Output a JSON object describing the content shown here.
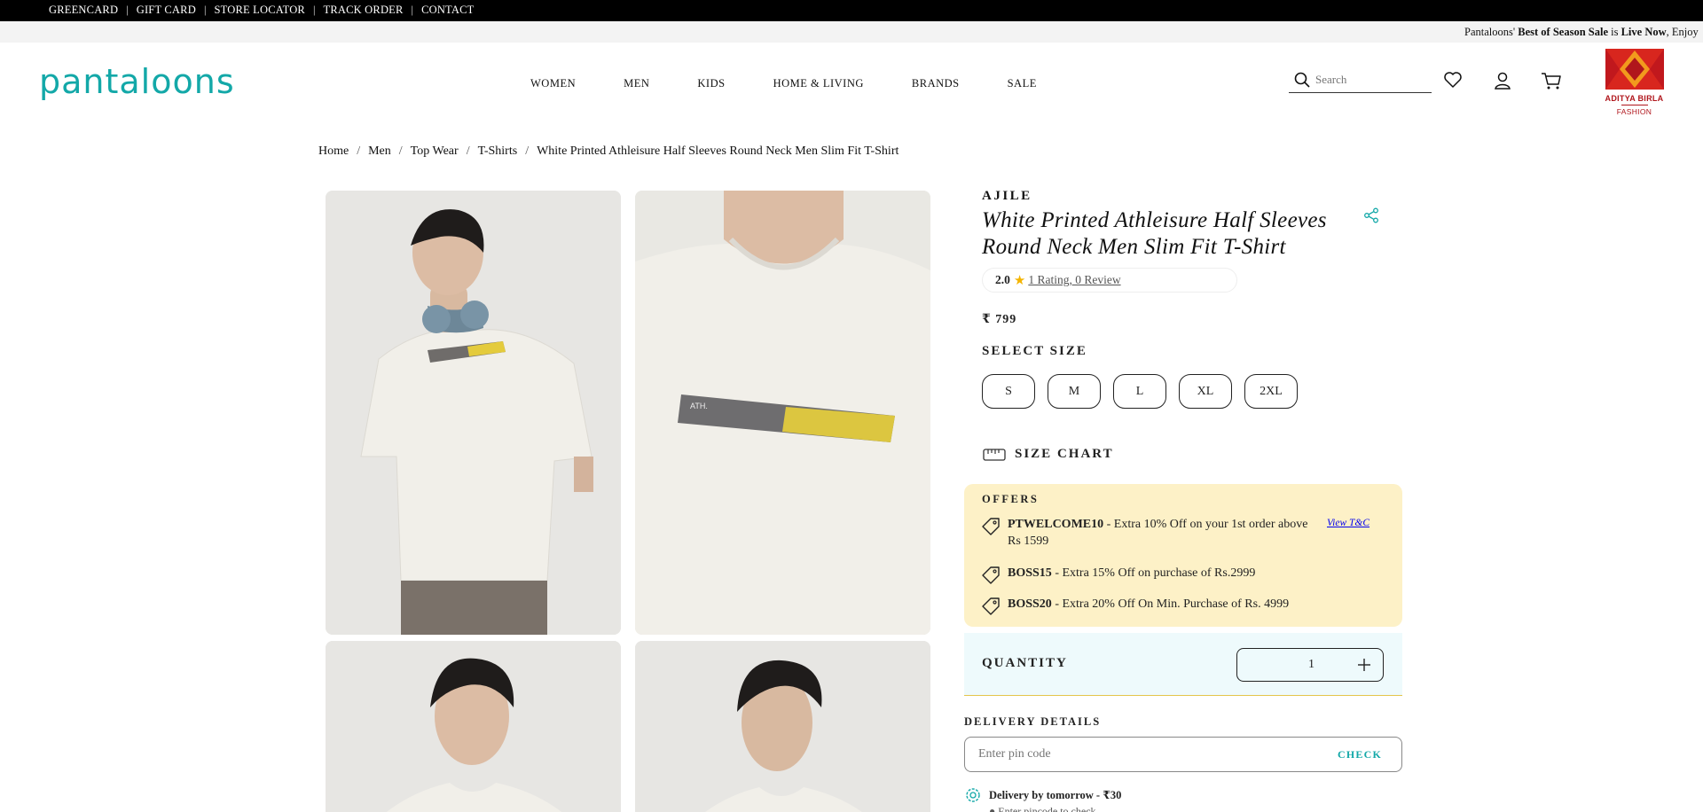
{
  "topbar": {
    "links": [
      "GREENCARD",
      "GIFT CARD",
      "STORE LOCATOR",
      "TRACK ORDER",
      "CONTACT"
    ]
  },
  "announcement": {
    "prefix": "Pantaloons'",
    "bold1": "Best of Season Sale",
    "mid": "is",
    "bold2": "Live Now",
    "suffix": ", Enjoy"
  },
  "header": {
    "logo": "pantaloons",
    "nav": [
      "WOMEN",
      "MEN",
      "KIDS",
      "HOME & LIVING",
      "BRANDS",
      "SALE"
    ],
    "search_placeholder": "Search",
    "partner_logo": {
      "name": "ADITYA BIRLA",
      "sub": "FASHION"
    }
  },
  "breadcrumb": [
    "Home",
    "Men",
    "Top Wear",
    "T-Shirts",
    "White Printed Athleisure Half Sleeves Round Neck Men Slim Fit T-Shirt"
  ],
  "product": {
    "brand": "AJILE",
    "title": "White Printed Athleisure Half Sleeves Round Neck Men Slim Fit T-Shirt",
    "rating_value": "2.0",
    "rating_text": " 1 Rating, 0 Review",
    "price": "₹ 799",
    "select_size_label": "SELECT SIZE",
    "sizes": [
      "S",
      "M",
      "L",
      "XL",
      "2XL"
    ],
    "size_chart_label": "SIZE CHART",
    "image_print_text": "ATH."
  },
  "offers": {
    "heading": "OFFERS",
    "items": [
      {
        "code": "PTWELCOME10",
        "text": " - Extra 10% Off on your 1st order above Rs 1599",
        "link": "View T&C"
      },
      {
        "code": "BOSS15",
        "text": " - Extra 15% Off on purchase of Rs.2999"
      },
      {
        "code": "BOSS20",
        "text": " - Extra 20% Off On Min. Purchase of Rs. 4999"
      }
    ]
  },
  "quantity": {
    "label": "QUANTITY",
    "value": "1"
  },
  "delivery": {
    "heading": "DELIVERY DETAILS",
    "pin_placeholder": "Enter pin code",
    "check_label": "CHECK",
    "by_text": "Delivery by tomorrow - ₹30",
    "sub_text": "● Enter pincode to check"
  },
  "colors": {
    "brand_teal": "#13a8a8",
    "offer_bg": "#fdf1c7",
    "qty_bg": "#eefafc",
    "star": "#f4b400",
    "birla_red": "#b0161c"
  }
}
